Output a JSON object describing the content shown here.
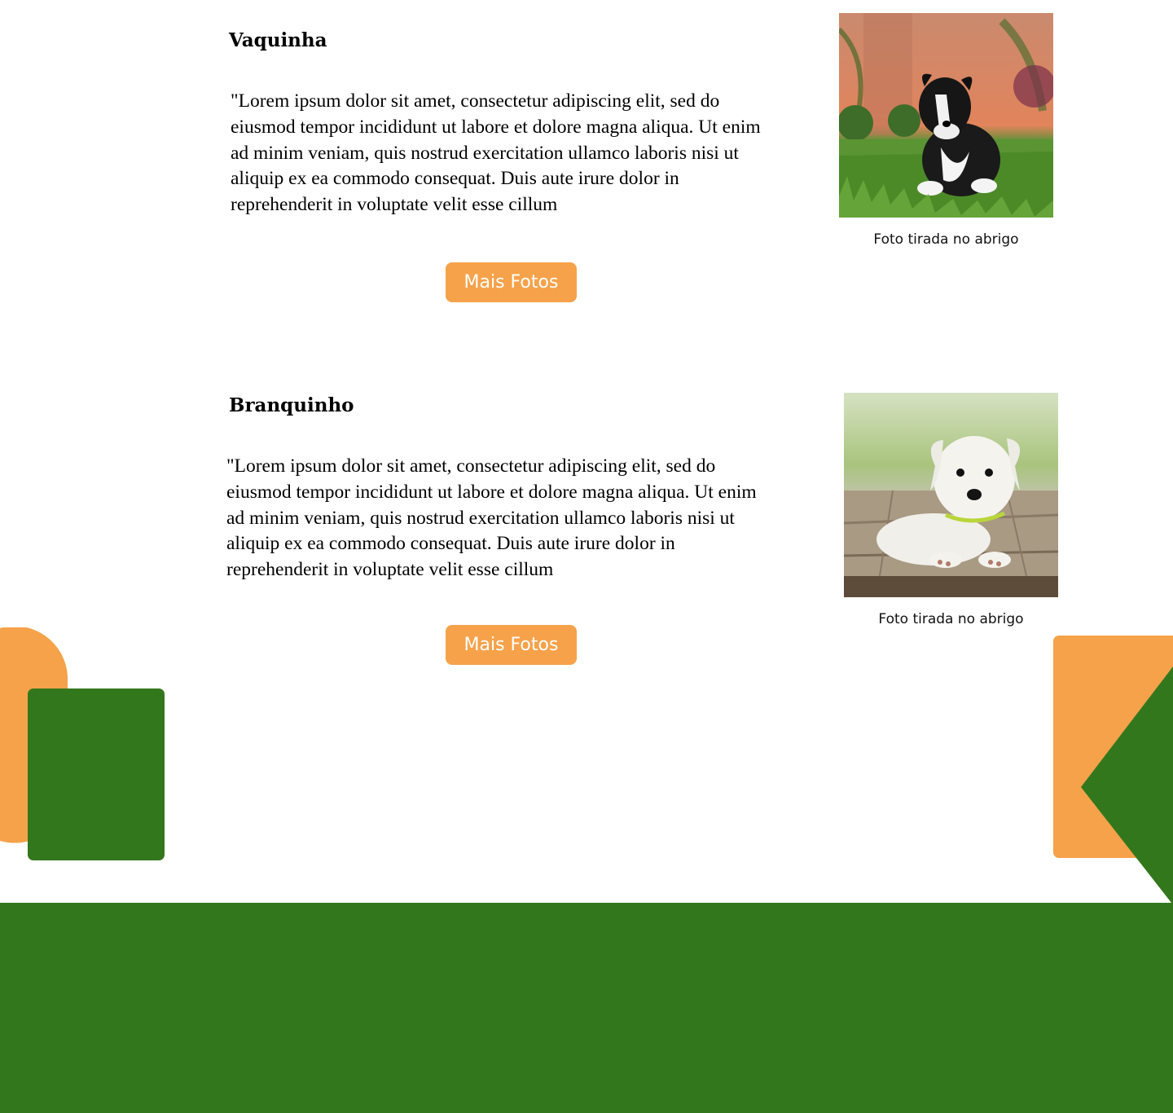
{
  "colors": {
    "orange": "#f6a24a",
    "green": "#33771d",
    "white": "#ffffff"
  },
  "pets": [
    {
      "name": "Vaquinha",
      "description": "\"Lorem ipsum dolor sit amet, consectetur adipiscing elit, sed do eiusmod tempor incididunt ut labore et dolore magna aliqua. Ut enim ad minim veniam, quis nostrud exercitation ullamco laboris nisi ut aliquip ex ea commodo consequat. Duis aute irure dolor in reprehenderit in voluptate velit esse cillum",
      "button_label": "Mais Fotos",
      "photo_caption": "Foto tirada no abrigo"
    },
    {
      "name": "Branquinho",
      "description": "\"Lorem ipsum dolor sit amet, consectetur adipiscing elit, sed do eiusmod tempor incididunt ut labore et dolore magna aliqua. Ut enim ad minim veniam, quis nostrud exercitation ullamco laboris nisi ut aliquip ex ea commodo consequat. Duis aute irure dolor in reprehenderit in voluptate velit esse cillum",
      "button_label": "Mais Fotos",
      "photo_caption": "Foto tirada no abrigo"
    }
  ]
}
